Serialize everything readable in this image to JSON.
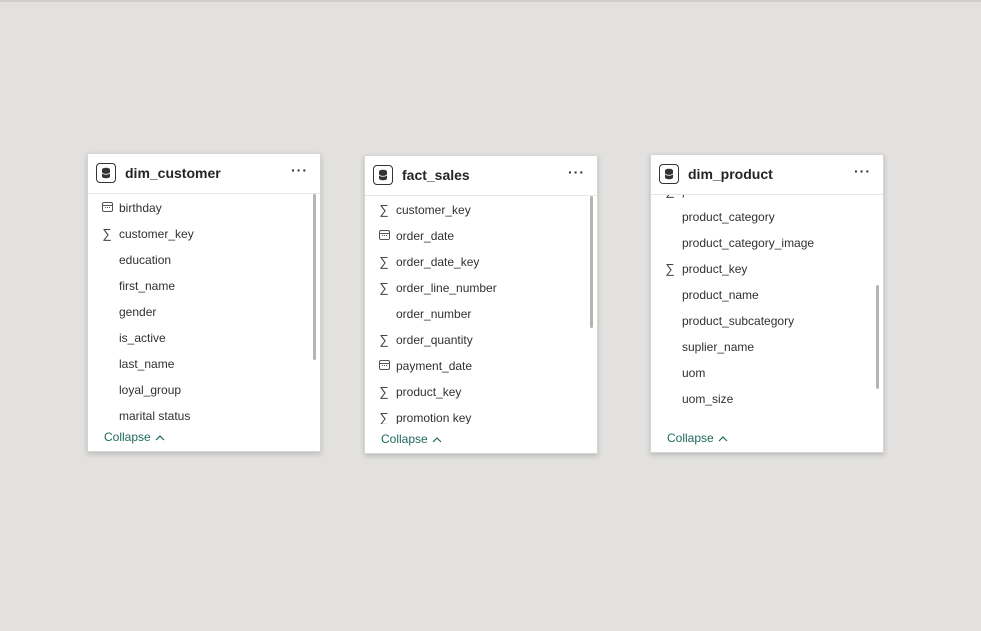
{
  "cards": [
    {
      "title": "dim_customer",
      "more_label": "···",
      "collapse_label": "Collapse",
      "fields": [
        {
          "label": "birthday",
          "icon": "calendar-icon"
        },
        {
          "label": "customer_key",
          "icon": "sigma-icon"
        },
        {
          "label": "education",
          "icon": "none"
        },
        {
          "label": "first_name",
          "icon": "none"
        },
        {
          "label": "gender",
          "icon": "none"
        },
        {
          "label": "is_active",
          "icon": "none"
        },
        {
          "label": "last_name",
          "icon": "none"
        },
        {
          "label": "loyal_group",
          "icon": "none"
        },
        {
          "label": "marital status",
          "icon": "none"
        }
      ]
    },
    {
      "title": "fact_sales",
      "more_label": "···",
      "collapse_label": "Collapse",
      "fields": [
        {
          "label": "customer_key",
          "icon": "sigma-icon"
        },
        {
          "label": "order_date",
          "icon": "calendar-icon"
        },
        {
          "label": "order_date_key",
          "icon": "sigma-icon"
        },
        {
          "label": "order_line_number",
          "icon": "sigma-icon"
        },
        {
          "label": "order_number",
          "icon": "none"
        },
        {
          "label": "order_quantity",
          "icon": "sigma-icon"
        },
        {
          "label": "payment_date",
          "icon": "calendar-icon"
        },
        {
          "label": "product_key",
          "icon": "sigma-icon"
        },
        {
          "label": "promotion key",
          "icon": "sigma-icon"
        }
      ]
    },
    {
      "title": "dim_product",
      "more_label": "···",
      "collapse_label": "Collapse",
      "fields": [
        {
          "label": "price",
          "icon": "sigma-icon"
        },
        {
          "label": "product_category",
          "icon": "none"
        },
        {
          "label": "product_category_image",
          "icon": "none"
        },
        {
          "label": "product_key",
          "icon": "sigma-icon"
        },
        {
          "label": "product_name",
          "icon": "none"
        },
        {
          "label": "product_subcategory",
          "icon": "none"
        },
        {
          "label": "suplier_name",
          "icon": "none"
        },
        {
          "label": "uom",
          "icon": "none"
        },
        {
          "label": "uom_size",
          "icon": "none"
        },
        {
          "label": "",
          "icon": "none"
        }
      ]
    }
  ]
}
